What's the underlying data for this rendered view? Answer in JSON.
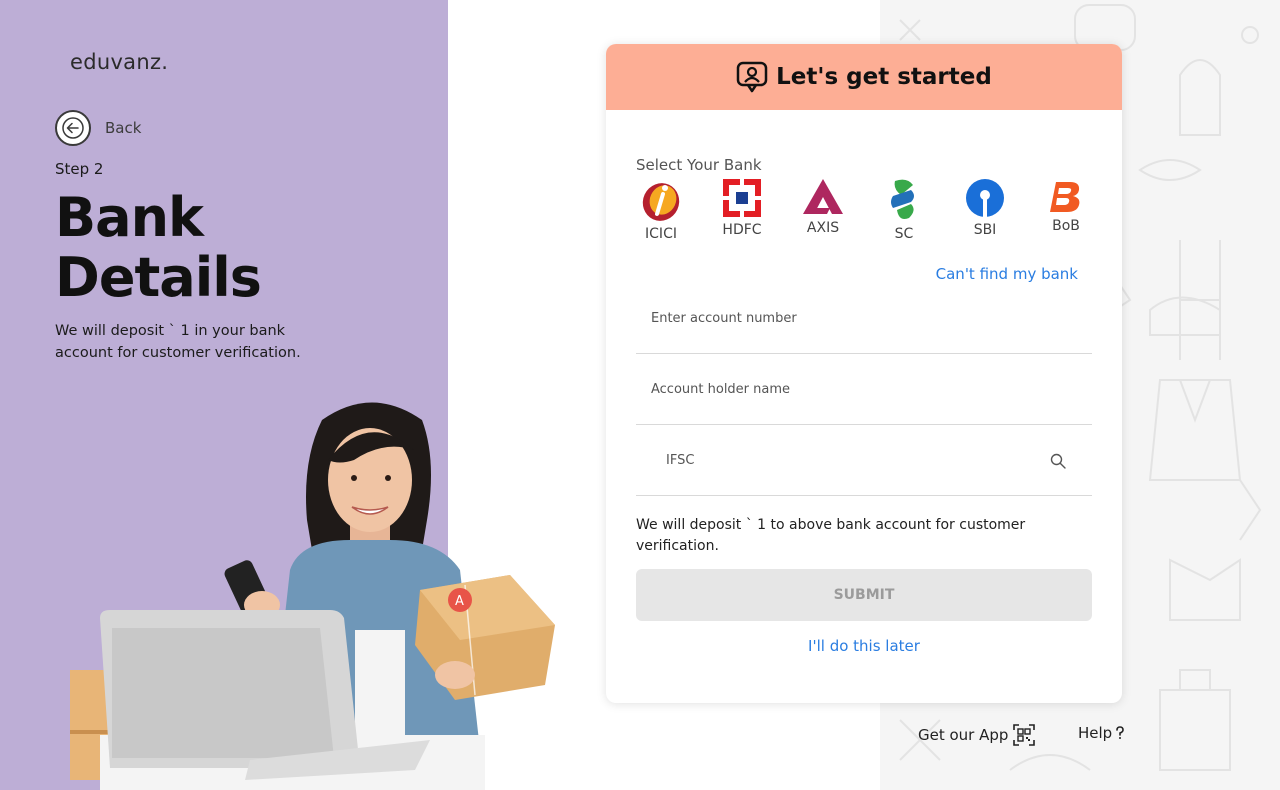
{
  "brand": {
    "logo_text": "eduvanz."
  },
  "nav": {
    "back_label": "Back"
  },
  "intro": {
    "step": "Step 2",
    "title_line1": "Bank",
    "title_line2": "Details",
    "description": "We will deposit ` 1 in your bank account for customer verification."
  },
  "card": {
    "header_title": "Let's get started",
    "header_icon": "user-chat-icon",
    "select_bank_label": "Select Your Bank",
    "banks": [
      {
        "name": "ICICI",
        "icon": "icici-logo",
        "color": "#b5202e"
      },
      {
        "name": "HDFC",
        "icon": "hdfc-logo",
        "color": "#e31e24"
      },
      {
        "name": "AXIS",
        "icon": "axis-logo",
        "color": "#ae275f"
      },
      {
        "name": "SC",
        "icon": "standard-chartered-logo",
        "color": "#38a94a"
      },
      {
        "name": "SBI",
        "icon": "sbi-logo",
        "color": "#1a6fd8"
      },
      {
        "name": "BoB",
        "icon": "bob-logo",
        "color": "#f15a22"
      }
    ],
    "cant_find_link": "Can't find my bank",
    "fields": {
      "account_number_placeholder": "Enter account number",
      "holder_name_placeholder": "Account holder name",
      "ifsc_placeholder": "IFSC"
    },
    "note": "We will deposit ` 1 to above bank account for customer verification.",
    "submit_label": "SUBMIT",
    "later_link": "I'll do this later"
  },
  "footer": {
    "app_label": "Get our App",
    "app_icon": "qr-code-icon",
    "help_label": "Help"
  },
  "colors": {
    "left_panel": "#bdaed6",
    "header": "#fdae95",
    "link": "#2a7de1",
    "submit_disabled": "#e6e6e6"
  }
}
